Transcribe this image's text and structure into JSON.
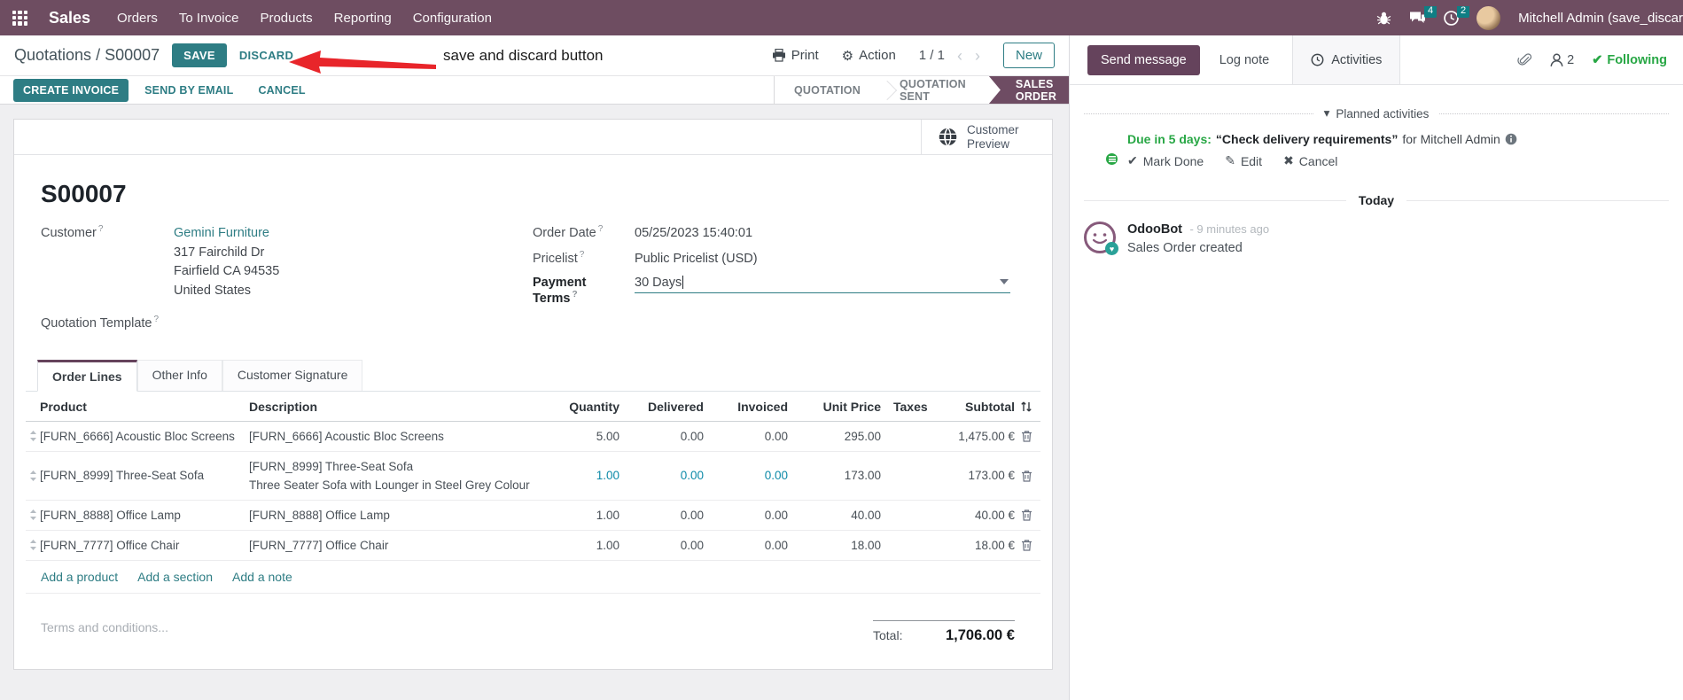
{
  "nav": {
    "app_name": "Sales",
    "menus": [
      "Orders",
      "To Invoice",
      "Products",
      "Reporting",
      "Configuration"
    ],
    "messages_badge": "4",
    "activities_badge": "2",
    "user": "Mitchell Admin (save_discar"
  },
  "breadcrumb": {
    "parent": "Quotations",
    "sep": "/",
    "current": "S00007"
  },
  "edit_controls": {
    "save": "SAVE",
    "discard": "DISCARD"
  },
  "annotation": "save and discard button",
  "toolbar": {
    "print": "Print",
    "action": "Action",
    "pager": "1 / 1",
    "prev": "‹",
    "next": "›",
    "new": "New"
  },
  "statusbar": {
    "buttons": [
      "CREATE INVOICE",
      "SEND BY EMAIL",
      "CANCEL"
    ],
    "steps": [
      "QUOTATION",
      "QUOTATION SENT",
      "SALES ORDER"
    ]
  },
  "sheet": {
    "customer_preview": "Customer Preview",
    "title": "S00007",
    "help": "?",
    "left": {
      "customer_label": "Customer",
      "customer_name": "Gemini Furniture",
      "address": [
        "317 Fairchild Dr",
        "Fairfield CA 94535",
        "United States"
      ],
      "quotation_template_label": "Quotation Template"
    },
    "right": {
      "order_date_label": "Order Date",
      "order_date": "05/25/2023 15:40:01",
      "pricelist_label": "Pricelist",
      "pricelist": "Public Pricelist (USD)",
      "payment_terms_label": "Payment Terms",
      "payment_terms": "30 Days"
    },
    "tabs": [
      "Order Lines",
      "Other Info",
      "Customer Signature"
    ],
    "table": {
      "headers": {
        "product": "Product",
        "description": "Description",
        "quantity": "Quantity",
        "delivered": "Delivered",
        "invoiced": "Invoiced",
        "unit_price": "Unit Price",
        "taxes": "Taxes",
        "subtotal": "Subtotal"
      },
      "rows": [
        {
          "product": "[FURN_6666] Acoustic Bloc Screens",
          "description": "[FURN_6666] Acoustic Bloc Screens",
          "description2": "",
          "quantity": "5.00",
          "delivered": "0.00",
          "invoiced": "0.00",
          "unit_price": "295.00",
          "taxes": "",
          "subtotal": "1,475.00 €"
        },
        {
          "product": "[FURN_8999] Three-Seat Sofa",
          "description": "[FURN_8999] Three-Seat Sofa",
          "description2": "Three Seater Sofa with Lounger in Steel Grey Colour",
          "quantity": "1.00",
          "delivered": "0.00",
          "invoiced": "0.00",
          "unit_price": "173.00",
          "taxes": "",
          "subtotal": "173.00 €"
        },
        {
          "product": "[FURN_8888] Office Lamp",
          "description": "[FURN_8888] Office Lamp",
          "description2": "",
          "quantity": "1.00",
          "delivered": "0.00",
          "invoiced": "0.00",
          "unit_price": "40.00",
          "taxes": "",
          "subtotal": "40.00 €"
        },
        {
          "product": "[FURN_7777] Office Chair",
          "description": "[FURN_7777] Office Chair",
          "description2": "",
          "quantity": "1.00",
          "delivered": "0.00",
          "invoiced": "0.00",
          "unit_price": "18.00",
          "taxes": "",
          "subtotal": "18.00 €"
        }
      ],
      "links": [
        "Add a product",
        "Add a section",
        "Add a note"
      ],
      "terms_placeholder": "Terms and conditions...",
      "total_label": "Total:",
      "total_value": "1,706.00 €"
    }
  },
  "chatter": {
    "send_message": "Send message",
    "log_note": "Log note",
    "activities": "Activities",
    "followers": "2",
    "following": "Following",
    "planned": {
      "title": "Planned activities",
      "due": "Due in 5 days:",
      "summary": "“Check delivery requirements”",
      "assignee": "for Mitchell Admin",
      "mark_done": "Mark Done",
      "edit": "Edit",
      "cancel": "Cancel"
    },
    "date_divider": "Today",
    "message": {
      "author": "OdooBot",
      "time": "- 9 minutes ago",
      "body": "Sales Order created"
    }
  },
  "colors": {
    "brand_purple": "#6e4d61",
    "accent_teal": "#2e7d84",
    "status_purple": "#65435c",
    "success_green": "#28a745",
    "modified_blue": "#0d8aa8",
    "annotation_red": "#e8252a"
  }
}
